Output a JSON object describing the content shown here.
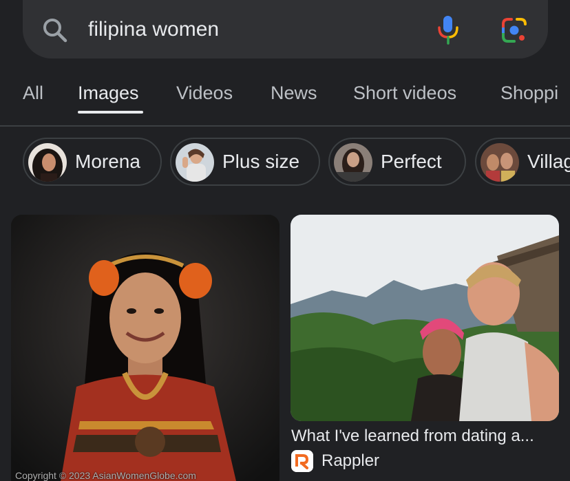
{
  "search": {
    "query": "filipina women"
  },
  "tabs": [
    {
      "label": "All",
      "active": false
    },
    {
      "label": "Images",
      "active": true
    },
    {
      "label": "Videos",
      "active": false
    },
    {
      "label": "News",
      "active": false
    },
    {
      "label": "Short videos",
      "active": false
    },
    {
      "label": "Shoppi",
      "active": false
    }
  ],
  "chips": [
    {
      "label": "Morena"
    },
    {
      "label": "Plus size"
    },
    {
      "label": "Perfect"
    },
    {
      "label": "Villag"
    }
  ],
  "results": {
    "left": {
      "watermark": "Copyright © 2023 AsianWomenGlobe.com"
    },
    "right": {
      "title": "What I've learned from dating a...",
      "source": "Rappler"
    }
  },
  "colors": {
    "background": "#202124",
    "searchbar": "#303134",
    "text": "#e8eaed",
    "muted_text": "#bdc1c6",
    "rappler_orange": "#f26b21"
  },
  "icons": {
    "search": "search-icon",
    "mic": "mic-icon",
    "lens": "lens-icon",
    "source": "rappler-logo-icon"
  }
}
